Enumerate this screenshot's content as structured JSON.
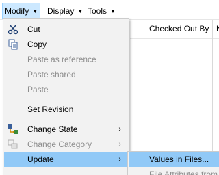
{
  "menubar": {
    "items": [
      {
        "label": "Modify"
      },
      {
        "label": "Display"
      },
      {
        "label": "Tools"
      }
    ]
  },
  "background": {
    "column_header": "Checked Out By",
    "column_header_2": "N"
  },
  "menu": {
    "items": [
      {
        "label": "Cut",
        "icon": "scissors-icon"
      },
      {
        "label": "Copy",
        "icon": "copy-icon"
      },
      {
        "label": "Paste as reference"
      },
      {
        "label": "Paste shared"
      },
      {
        "label": "Paste"
      },
      {
        "label": "Set Revision"
      },
      {
        "label": "Change State",
        "icon": "change-state-icon"
      },
      {
        "label": "Change Category",
        "icon": "change-category-icon"
      },
      {
        "label": "Update"
      }
    ]
  },
  "submenu": {
    "items": [
      {
        "label": "Values in Files..."
      },
      {
        "label": "File Attributes from"
      }
    ]
  },
  "colors": {
    "highlight": "#91c9f7",
    "menubar_active": "#cce8ff",
    "menu_bg": "#f2f2f2",
    "disabled_text": "#8d8d8d"
  }
}
